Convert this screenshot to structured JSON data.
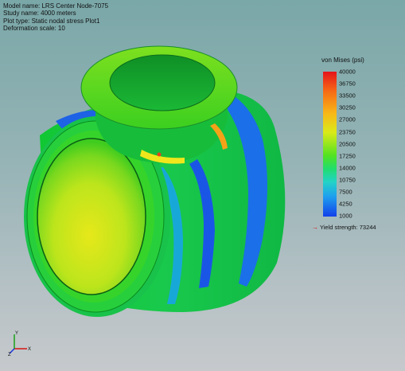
{
  "model_info": {
    "model_name": "Model name: LRS Center Node-7075",
    "study_name": "Study name: 4000 meters",
    "plot_type": "Plot type: Static nodal stress Plot1",
    "deformation_scale": "Deformation scale: 10"
  },
  "legend": {
    "title": "von Mises (psi)",
    "ticks": [
      "40000",
      "36750",
      "33500",
      "30250",
      "27000",
      "23750",
      "20500",
      "17250",
      "14000",
      "10750",
      "7500",
      "4250",
      "1000"
    ],
    "yield_label": "Yield strength: 73244",
    "colors": {
      "max": "#e5141a",
      "high": "#f76d16",
      "mid_high": "#f9b818",
      "mid": "#52e222",
      "mid_low": "#23d3c6",
      "low": "#1ea0ee",
      "min": "#1341ea",
      "yield_marker": "#d81414"
    }
  },
  "axis_triad": {
    "x": "X",
    "y": "Y",
    "z": "Z"
  }
}
